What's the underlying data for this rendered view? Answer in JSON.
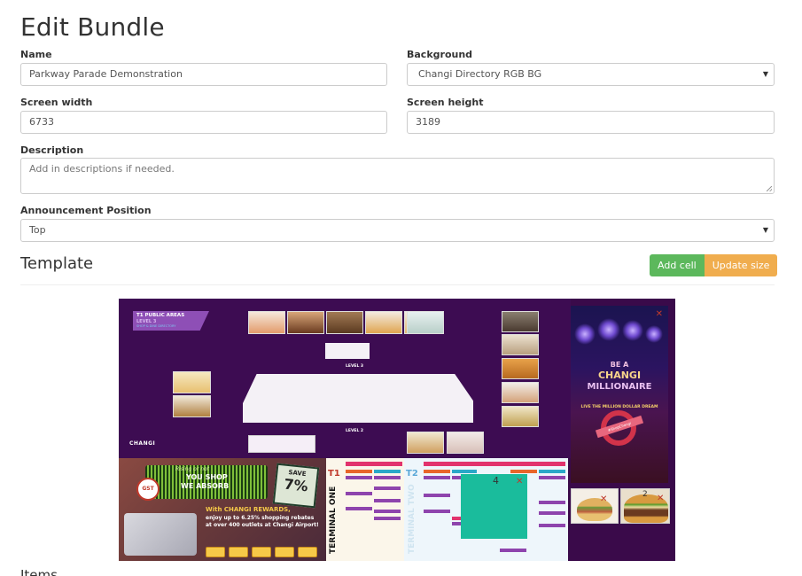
{
  "page": {
    "title": "Edit Bundle"
  },
  "form": {
    "name": {
      "label": "Name",
      "value": "Parkway Parade Demonstration"
    },
    "background": {
      "label": "Background",
      "selected": "Changi Directory RGB BG"
    },
    "screen_width": {
      "label": "Screen width",
      "value": "6733"
    },
    "screen_height": {
      "label": "Screen height",
      "value": "3189"
    },
    "description": {
      "label": "Description",
      "placeholder": "Add in descriptions if needed."
    },
    "announcement_position": {
      "label": "Announcement Position",
      "selected": "Top"
    }
  },
  "template": {
    "title": "Template",
    "buttons": {
      "add_cell": "Add cell",
      "update_size": "Update size"
    },
    "colors": {
      "add_cell": "#5cb85c",
      "update_size": "#f0ad4e",
      "selected_cell": "#1abc9c",
      "canvas_bg": "#3a0a4a"
    },
    "cells": [
      {
        "id": "map",
        "banner_line1": "T1 PUBLIC AREAS",
        "banner_line2": "LEVEL 3",
        "banner_line3": "SHOP & DINE DIRECTORY",
        "level_top": "LEVEL 3",
        "level_bottom": "LEVEL 2",
        "logo": "CHANGI"
      },
      {
        "id": "ad",
        "line1": "BE A",
        "line2": "CHANGI",
        "line3": "MILLIONAIRE",
        "tagline": "LIVE THE MILLION DOLLAR DREAM",
        "hashtag": "#ShopChangi",
        "close": "✕"
      },
      {
        "id": "rewards",
        "barcode_line1": "Rising or not",
        "barcode_line2": "YOU SHOP",
        "barcode_line3": "WE ABSORB",
        "gst": "GST",
        "save_line1": "SAVE",
        "save_line2": "7%",
        "promo_line1": "With CHANGI REWARDS,",
        "promo_line2": "enjoy up to 6.25% shopping rebates",
        "promo_line3": "at over 400 outlets at Changi Airport!"
      },
      {
        "id": "terminal-one",
        "badge": "T1",
        "vertical": "TERMINAL ONE"
      },
      {
        "id": "terminal-two",
        "badge": "T2",
        "vertical": "TERMINAL TWO"
      },
      {
        "id": "selected",
        "number": "4",
        "close": "✕"
      },
      {
        "id": "burger-1",
        "close": "✕"
      },
      {
        "id": "burger-2",
        "number": "2",
        "close": "✕"
      }
    ]
  },
  "items": {
    "title": "Items"
  }
}
